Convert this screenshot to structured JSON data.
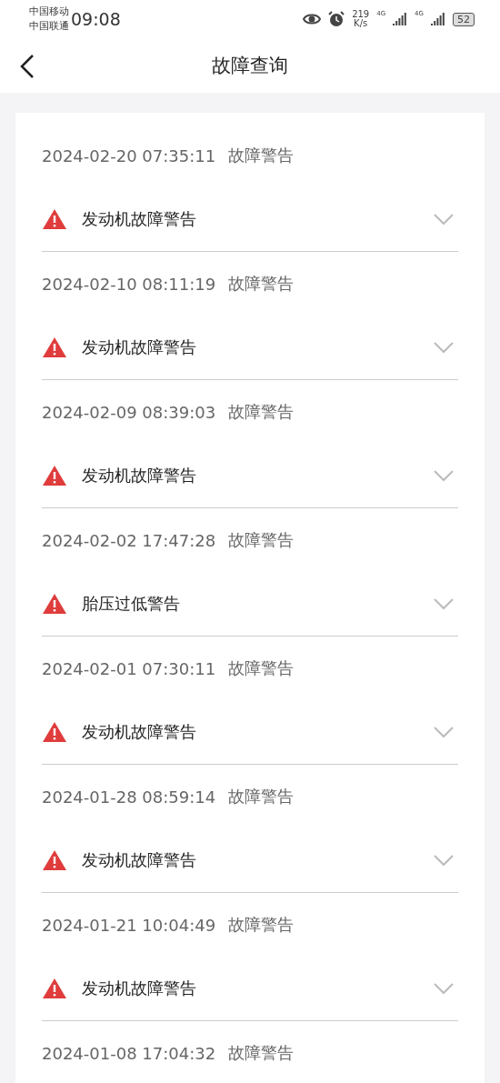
{
  "status_bar": {
    "carriers": [
      "中国移动",
      "中国联通"
    ],
    "time": "09:08",
    "speed": "219",
    "speed_unit": "K/s",
    "network_1": "4G",
    "network_2": "4G",
    "battery": "52"
  },
  "header": {
    "title": "故障查询"
  },
  "records": [
    {
      "datetime": "2024-02-20 07:35:11",
      "type": "故障警告",
      "alert": "发动机故障警告"
    },
    {
      "datetime": "2024-02-10 08:11:19",
      "type": "故障警告",
      "alert": "发动机故障警告"
    },
    {
      "datetime": "2024-02-09 08:39:03",
      "type": "故障警告",
      "alert": "发动机故障警告"
    },
    {
      "datetime": "2024-02-02 17:47:28",
      "type": "故障警告",
      "alert": "胎压过低警告"
    },
    {
      "datetime": "2024-02-01 07:30:11",
      "type": "故障警告",
      "alert": "发动机故障警告"
    },
    {
      "datetime": "2024-01-28 08:59:14",
      "type": "故障警告",
      "alert": "发动机故障警告"
    },
    {
      "datetime": "2024-01-21 10:04:49",
      "type": "故障警告",
      "alert": "发动机故障警告"
    },
    {
      "datetime": "2024-01-08 17:04:32",
      "type": "故障警告"
    }
  ]
}
